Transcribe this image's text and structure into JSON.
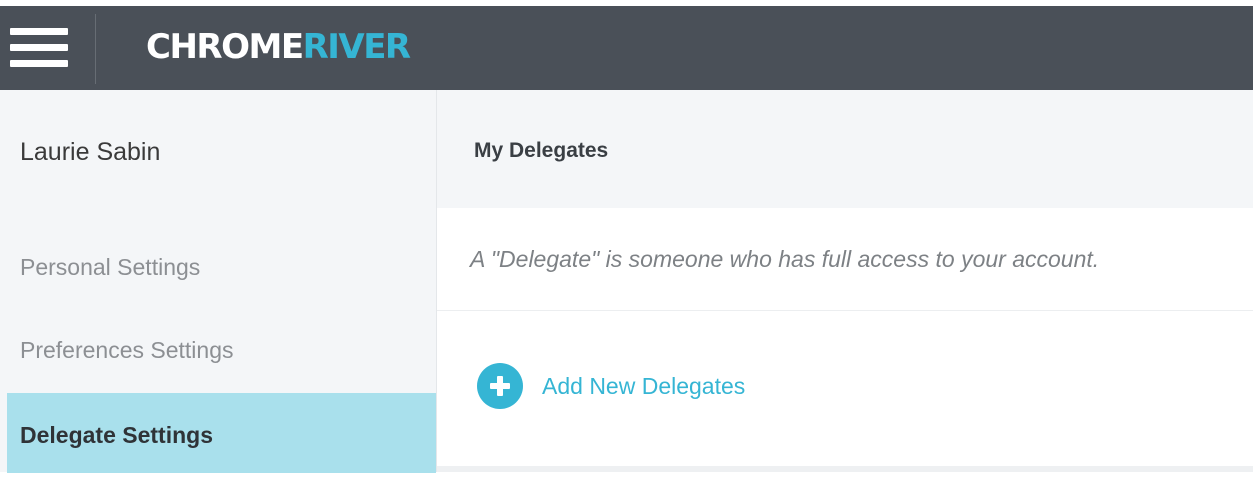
{
  "header": {
    "logo_part1": "CHROME",
    "logo_part2": "RIVER",
    "menu_icon": "hamburger-menu-icon"
  },
  "sidebar": {
    "user_name": "Laurie Sabin",
    "items": [
      {
        "label": "Personal Settings",
        "active": false
      },
      {
        "label": "Preferences Settings",
        "active": false
      },
      {
        "label": "Delegate Settings",
        "active": true
      }
    ]
  },
  "main": {
    "title": "My Delegates",
    "description": "A \"Delegate\" is someone who has full access to your account.",
    "add_button_label": "Add New Delegates",
    "add_icon": "plus-circle-icon"
  },
  "colors": {
    "topbar": "#4a5058",
    "accent": "#35b5d4",
    "active_item": "#a9e0ec",
    "sidebar_bg": "#f4f6f8"
  }
}
